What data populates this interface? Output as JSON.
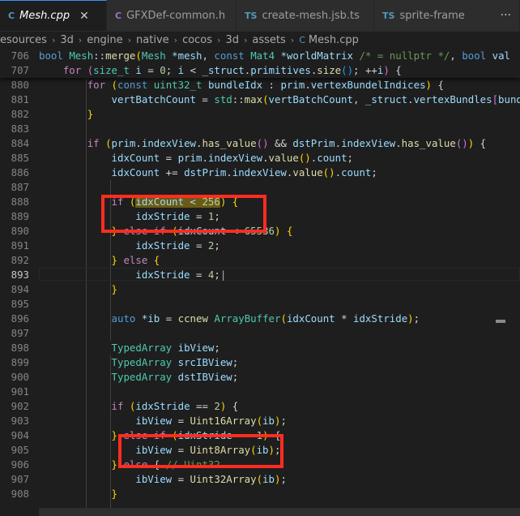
{
  "tabs": [
    {
      "icon": "C",
      "icon_class": "ico-cpp",
      "label": "Mesh.cpp",
      "active": true,
      "close": "✕"
    },
    {
      "icon": "C",
      "icon_class": "ico-h",
      "label": "GFXDef-common.h"
    },
    {
      "icon": "TS",
      "icon_class": "ico-ts",
      "label": "create-mesh.jsb.ts"
    },
    {
      "icon": "TS",
      "icon_class": "ico-ts",
      "label": "sprite-frame",
      "more": "···"
    }
  ],
  "breadcrumb": {
    "parts": [
      "esources",
      "3d",
      "engine",
      "native",
      "cocos",
      "3d",
      "assets"
    ],
    "file_icon": "C",
    "file": "Mesh.cpp",
    "separator": "›"
  },
  "sticky_lines": [
    {
      "n": "706",
      "tokens": [
        [
          "kw",
          "bool"
        ],
        [
          "",
          "&nbsp;"
        ],
        [
          "ty",
          "Mesh"
        ],
        [
          "",
          "::"
        ],
        [
          "fn",
          "merge"
        ],
        [
          "br",
          "("
        ],
        [
          "ty",
          "Mesh"
        ],
        [
          "",
          " "
        ],
        [
          "var",
          "*mesh"
        ],
        [
          "",
          ", "
        ],
        [
          "kw",
          "const"
        ],
        [
          "",
          " "
        ],
        [
          "ty",
          "Mat4"
        ],
        [
          "",
          " "
        ],
        [
          "var",
          "*worldMatrix"
        ],
        [
          "",
          " "
        ],
        [
          "com",
          "/* = nullptr */"
        ],
        [
          "",
          ", "
        ],
        [
          "kw",
          "bool"
        ],
        [
          "",
          " "
        ],
        [
          "var",
          "val"
        ]
      ]
    },
    {
      "n": "707",
      "tokens": [
        [
          "",
          "    "
        ],
        [
          "ctl",
          "for"
        ],
        [
          "",
          " "
        ],
        [
          "br2",
          "("
        ],
        [
          "ty",
          "size_t"
        ],
        [
          "",
          " "
        ],
        [
          "var",
          "i"
        ],
        [
          "",
          " = "
        ],
        [
          "num",
          "0"
        ],
        [
          "",
          "; "
        ],
        [
          "var",
          "i"
        ],
        [
          "",
          " < "
        ],
        [
          "var",
          "_struct"
        ],
        [
          "",
          "."
        ],
        [
          "var",
          "primitives"
        ],
        [
          "",
          "."
        ],
        [
          "fn",
          "size"
        ],
        [
          "br3",
          "()"
        ],
        [
          "",
          "; ++"
        ],
        [
          "var",
          "i"
        ],
        [
          "br2",
          ")"
        ],
        [
          "",
          " {"
        ]
      ]
    }
  ],
  "lines": [
    {
      "n": "880",
      "tokens": [
        [
          "",
          "        "
        ],
        [
          "ctl",
          "for"
        ],
        [
          "",
          " "
        ],
        [
          "br",
          "("
        ],
        [
          "kw",
          "const"
        ],
        [
          "",
          " "
        ],
        [
          "ty",
          "uint32_t"
        ],
        [
          "",
          " "
        ],
        [
          "var",
          "bundleIdx"
        ],
        [
          "",
          " : "
        ],
        [
          "var",
          "prim"
        ],
        [
          "",
          "."
        ],
        [
          "var",
          "vertexBundelIndices"
        ],
        [
          "br",
          ")"
        ],
        [
          "",
          " {"
        ]
      ]
    },
    {
      "n": "881",
      "tokens": [
        [
          "",
          "            "
        ],
        [
          "var",
          "vertBatchCount"
        ],
        [
          "",
          " = "
        ],
        [
          "ty",
          "std"
        ],
        [
          "",
          "::"
        ],
        [
          "fn",
          "max"
        ],
        [
          "br",
          "("
        ],
        [
          "var",
          "vertBatchCount"
        ],
        [
          "",
          ", "
        ],
        [
          "var",
          "_struct"
        ],
        [
          "",
          "."
        ],
        [
          "var",
          "vertexBundles"
        ],
        [
          "br2",
          "["
        ],
        [
          "var",
          "bund"
        ]
      ]
    },
    {
      "n": "882",
      "tokens": [
        [
          "",
          "        "
        ],
        [
          "br",
          "}"
        ]
      ]
    },
    {
      "n": "883",
      "tokens": []
    },
    {
      "n": "884",
      "tokens": [
        [
          "",
          "        "
        ],
        [
          "ctl",
          "if"
        ],
        [
          "",
          " "
        ],
        [
          "br",
          "("
        ],
        [
          "var",
          "prim"
        ],
        [
          "",
          "."
        ],
        [
          "var",
          "indexView"
        ],
        [
          "",
          "."
        ],
        [
          "fn",
          "has_value"
        ],
        [
          "br2",
          "()"
        ],
        [
          "",
          " && "
        ],
        [
          "var",
          "dstPrim"
        ],
        [
          "",
          "."
        ],
        [
          "var",
          "indexView"
        ],
        [
          "",
          "."
        ],
        [
          "fn",
          "has_value"
        ],
        [
          "br2",
          "()"
        ],
        [
          "br",
          ")"
        ],
        [
          "",
          " {"
        ]
      ]
    },
    {
      "n": "885",
      "tokens": [
        [
          "",
          "            "
        ],
        [
          "var",
          "idxCount"
        ],
        [
          "",
          " = "
        ],
        [
          "var",
          "prim"
        ],
        [
          "",
          "."
        ],
        [
          "var",
          "indexView"
        ],
        [
          "",
          "."
        ],
        [
          "fn",
          "value"
        ],
        [
          "br",
          "()"
        ],
        [
          "",
          "."
        ],
        [
          "var",
          "count"
        ],
        [
          "",
          ";"
        ]
      ]
    },
    {
      "n": "886",
      "tokens": [
        [
          "",
          "            "
        ],
        [
          "var",
          "idxCount"
        ],
        [
          "",
          " += "
        ],
        [
          "var",
          "dstPrim"
        ],
        [
          "",
          "."
        ],
        [
          "var",
          "indexView"
        ],
        [
          "",
          "."
        ],
        [
          "fn",
          "value"
        ],
        [
          "br",
          "()"
        ],
        [
          "",
          "."
        ],
        [
          "var",
          "count"
        ],
        [
          "",
          ";"
        ]
      ]
    },
    {
      "n": "887",
      "tokens": []
    },
    {
      "n": "888",
      "tokens": [
        [
          "",
          "            "
        ],
        [
          "ctl",
          "if"
        ],
        [
          "",
          " "
        ],
        [
          "br",
          "("
        ],
        [
          "var hl",
          "idxCount < "
        ],
        [
          "num hl",
          "256"
        ],
        [
          "br",
          ")"
        ],
        [
          "",
          " "
        ],
        [
          "br",
          "{"
        ]
      ]
    },
    {
      "n": "889",
      "tokens": [
        [
          "",
          "                "
        ],
        [
          "var",
          "idxStride"
        ],
        [
          "",
          " = "
        ],
        [
          "num",
          "1"
        ],
        [
          "",
          ";"
        ]
      ]
    },
    {
      "n": "890",
      "tokens": [
        [
          "",
          "            "
        ],
        [
          "br",
          "}"
        ],
        [
          "",
          " "
        ],
        [
          "ctl",
          "else if"
        ],
        [
          "",
          " "
        ],
        [
          "br",
          "("
        ],
        [
          "var",
          "idxCount"
        ],
        [
          "",
          " < "
        ],
        [
          "num",
          "65536"
        ],
        [
          "br",
          ")"
        ],
        [
          "",
          " "
        ],
        [
          "br",
          "{"
        ]
      ]
    },
    {
      "n": "891",
      "tokens": [
        [
          "",
          "                "
        ],
        [
          "var",
          "idxStride"
        ],
        [
          "",
          " = "
        ],
        [
          "num",
          "2"
        ],
        [
          "",
          ";"
        ]
      ]
    },
    {
      "n": "892",
      "tokens": [
        [
          "",
          "            "
        ],
        [
          "br",
          "}"
        ],
        [
          "",
          " "
        ],
        [
          "ctl",
          "else"
        ],
        [
          "",
          " "
        ],
        [
          "br",
          "{"
        ]
      ]
    },
    {
      "n": "893",
      "tokens": [
        [
          "",
          "                "
        ],
        [
          "var",
          "idxStride"
        ],
        [
          "",
          " = "
        ],
        [
          "num",
          "4"
        ],
        [
          "",
          ";|"
        ]
      ],
      "current": true
    },
    {
      "n": "894",
      "tokens": [
        [
          "",
          "            "
        ],
        [
          "br",
          "}"
        ]
      ]
    },
    {
      "n": "895",
      "tokens": []
    },
    {
      "n": "896",
      "tokens": [
        [
          "",
          "            "
        ],
        [
          "kw",
          "auto"
        ],
        [
          "",
          " "
        ],
        [
          "var",
          "*ib"
        ],
        [
          "",
          " = "
        ],
        [
          "fn",
          "ccnew"
        ],
        [
          "",
          " "
        ],
        [
          "ty",
          "ArrayBuffer"
        ],
        [
          "br",
          "("
        ],
        [
          "var",
          "idxCount"
        ],
        [
          "",
          " * "
        ],
        [
          "var",
          "idxStride"
        ],
        [
          "br",
          ")"
        ],
        [
          "",
          ";"
        ]
      ]
    },
    {
      "n": "897",
      "tokens": []
    },
    {
      "n": "898",
      "tokens": [
        [
          "",
          "            "
        ],
        [
          "ty",
          "TypedArray"
        ],
        [
          "",
          " "
        ],
        [
          "var",
          "ibView"
        ],
        [
          "",
          ";"
        ]
      ]
    },
    {
      "n": "899",
      "tokens": [
        [
          "",
          "            "
        ],
        [
          "ty",
          "TypedArray"
        ],
        [
          "",
          " "
        ],
        [
          "var",
          "srcIBView"
        ],
        [
          "",
          ";"
        ]
      ]
    },
    {
      "n": "900",
      "tokens": [
        [
          "",
          "            "
        ],
        [
          "ty",
          "TypedArray"
        ],
        [
          "",
          " "
        ],
        [
          "var",
          "dstIBView"
        ],
        [
          "",
          ";"
        ]
      ]
    },
    {
      "n": "901",
      "tokens": []
    },
    {
      "n": "902",
      "tokens": [
        [
          "",
          "            "
        ],
        [
          "ctl",
          "if"
        ],
        [
          "",
          " "
        ],
        [
          "br",
          "("
        ],
        [
          "var",
          "idxStride"
        ],
        [
          "",
          " == "
        ],
        [
          "num",
          "2"
        ],
        [
          "br",
          ")"
        ],
        [
          "",
          " {"
        ]
      ]
    },
    {
      "n": "903",
      "tokens": [
        [
          "",
          "                "
        ],
        [
          "var",
          "ibView"
        ],
        [
          "",
          " = "
        ],
        [
          "fn",
          "Uint16Array"
        ],
        [
          "br",
          "("
        ],
        [
          "var",
          "ib"
        ],
        [
          "br",
          ")"
        ],
        [
          "",
          ";"
        ]
      ]
    },
    {
      "n": "904",
      "tokens": [
        [
          "",
          "            "
        ],
        [
          "br",
          "}"
        ],
        [
          "",
          " "
        ],
        [
          "ctl",
          "else if"
        ],
        [
          "",
          " "
        ],
        [
          "br",
          "("
        ],
        [
          "var",
          "idxStride"
        ],
        [
          "",
          " == "
        ],
        [
          "num",
          "1"
        ],
        [
          "br",
          ")"
        ],
        [
          "",
          " {"
        ]
      ]
    },
    {
      "n": "905",
      "tokens": [
        [
          "",
          "                "
        ],
        [
          "var",
          "ibView"
        ],
        [
          "",
          " = "
        ],
        [
          "fn",
          "Uint8Array"
        ],
        [
          "br",
          "("
        ],
        [
          "var",
          "ib"
        ],
        [
          "br",
          ")"
        ],
        [
          "",
          ";"
        ]
      ]
    },
    {
      "n": "906",
      "tokens": [
        [
          "",
          "            "
        ],
        [
          "br",
          "}"
        ],
        [
          "",
          " "
        ],
        [
          "ctl",
          "else"
        ],
        [
          "",
          " { "
        ],
        [
          "com",
          "// Uint32"
        ]
      ]
    },
    {
      "n": "907",
      "tokens": [
        [
          "",
          "                "
        ],
        [
          "var",
          "ibView"
        ],
        [
          "",
          " = "
        ],
        [
          "fn",
          "Uint32Array"
        ],
        [
          "br",
          "("
        ],
        [
          "var",
          "ib"
        ],
        [
          "br",
          ")"
        ],
        [
          "",
          ";"
        ]
      ]
    },
    {
      "n": "908",
      "tokens": [
        [
          "",
          "            "
        ],
        [
          "br",
          "}"
        ]
      ]
    }
  ]
}
